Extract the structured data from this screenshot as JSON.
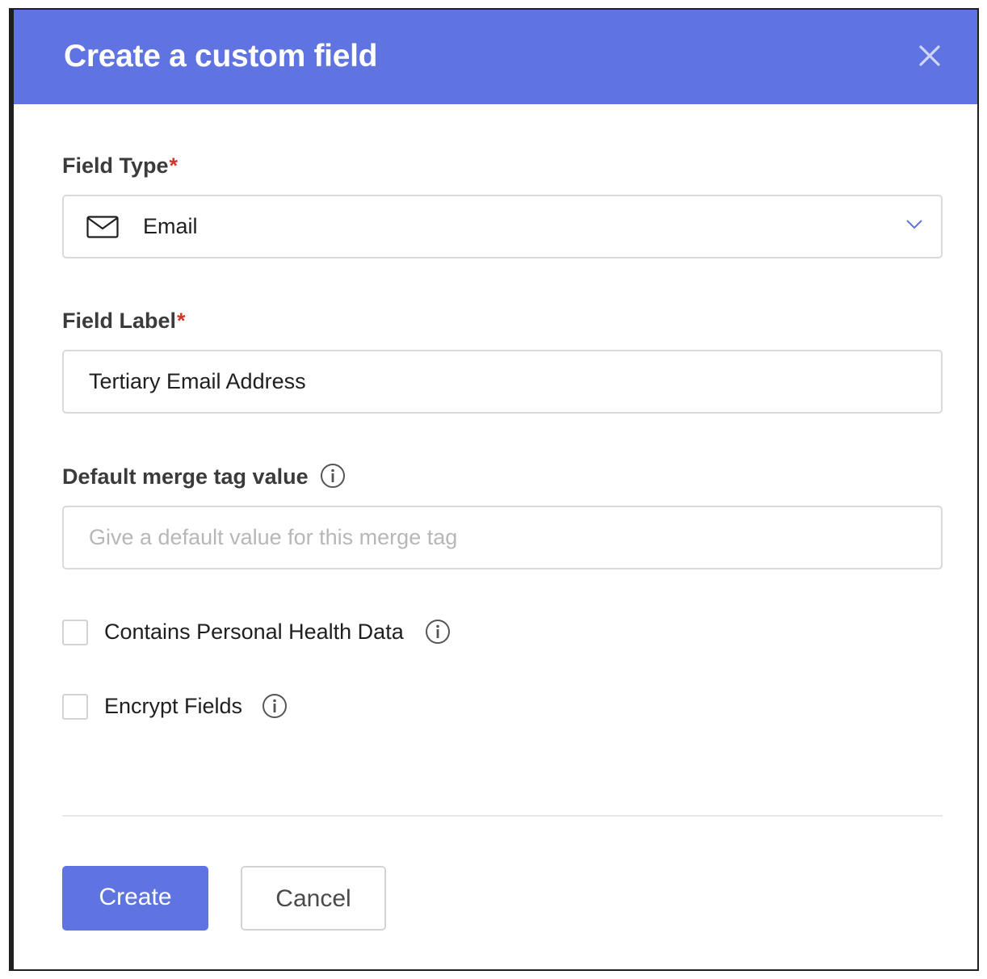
{
  "dialog": {
    "title": "Create a custom field",
    "accent_color": "#5f73e1",
    "close_icon": "close-icon"
  },
  "field_type": {
    "label": "Field Type",
    "required_marker": "*",
    "selected_value": "Email",
    "icon": "envelope-icon"
  },
  "field_label": {
    "label": "Field Label",
    "required_marker": "*",
    "value": "Tertiary Email Address"
  },
  "merge_tag": {
    "label": "Default merge tag value",
    "placeholder": "Give a default value for this merge tag",
    "value": ""
  },
  "options": {
    "phi": {
      "label": "Contains Personal Health Data",
      "checked": false
    },
    "encrypt": {
      "label": "Encrypt Fields",
      "checked": false
    }
  },
  "footer": {
    "create_label": "Create",
    "cancel_label": "Cancel"
  }
}
